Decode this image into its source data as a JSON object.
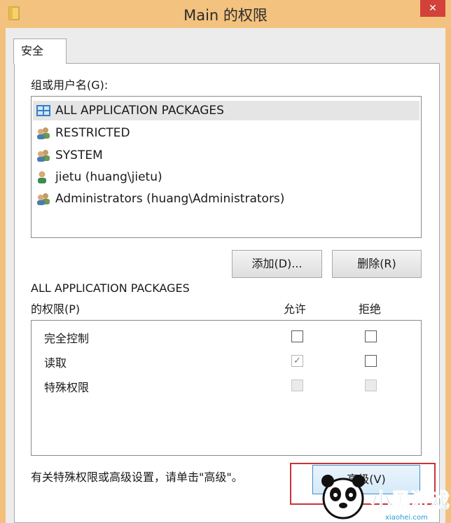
{
  "window": {
    "title": "Main 的权限",
    "close_glyph": "✕"
  },
  "tabs": [
    {
      "label": "安全"
    }
  ],
  "groups": {
    "label": "组或用户名(G):",
    "items": [
      {
        "name": "ALL APPLICATION PACKAGES",
        "icon": "app-packages-icon",
        "selected": true
      },
      {
        "name": "RESTRICTED",
        "icon": "users-group-icon"
      },
      {
        "name": "SYSTEM",
        "icon": "users-group-icon"
      },
      {
        "name": "jietu (huang\\jietu)",
        "icon": "user-icon"
      },
      {
        "name": "Administrators (huang\\Administrators)",
        "icon": "users-group-icon"
      }
    ]
  },
  "buttons": {
    "add": "添加(D)...",
    "remove": "删除(R)",
    "advanced": "高级(V)"
  },
  "permissions": {
    "title_line1": "ALL APPLICATION PACKAGES",
    "title_line2": "的权限(P)",
    "allow_header": "允许",
    "deny_header": "拒绝",
    "rows": [
      {
        "label": "完全控制",
        "allow": false,
        "deny": false,
        "enabled": true
      },
      {
        "label": "读取",
        "allow": true,
        "deny": false,
        "enabled": true,
        "allow_disabled": true
      },
      {
        "label": "特殊权限",
        "allow": false,
        "deny": false,
        "enabled": false
      }
    ]
  },
  "footer_text": "有关特殊权限或高级设置，请单击\"高级\"。",
  "watermark": {
    "text": "小黑游戏",
    "url": "xiaohei.com"
  },
  "colors": {
    "titlebar": "#f3c27e",
    "close": "#d2413a",
    "highlight": "#c9343a",
    "advanced_border": "#3c8ed3"
  }
}
